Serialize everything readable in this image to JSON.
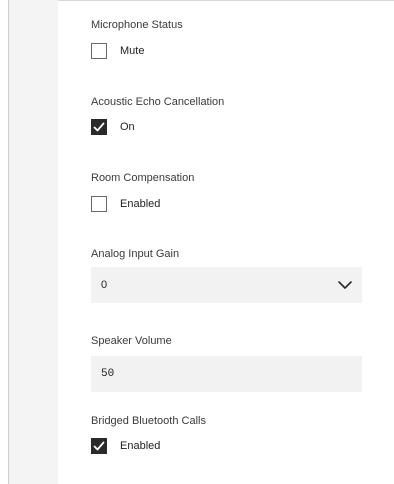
{
  "settings": {
    "microphone_status": {
      "label": "Microphone Status",
      "option": "Mute",
      "checked": false
    },
    "acoustic_echo_cancellation": {
      "label": "Acoustic Echo Cancellation",
      "option": "On",
      "checked": true
    },
    "room_compensation": {
      "label": "Room Compensation",
      "option": "Enabled",
      "checked": false
    },
    "analog_input_gain": {
      "label": "Analog Input Gain",
      "value": "0"
    },
    "speaker_volume": {
      "label": "Speaker Volume",
      "value": "50"
    },
    "bridged_bluetooth_calls": {
      "label": "Bridged Bluetooth Calls",
      "option": "Enabled",
      "checked": true
    }
  },
  "icons": {
    "checkmark": "checkmark-icon",
    "dropdown": "chevron-down-icon"
  },
  "colors": {
    "checked_fill": "#2a2a2a",
    "field_background": "#f2f2f2",
    "gutter_background": "#f4f4f4"
  }
}
